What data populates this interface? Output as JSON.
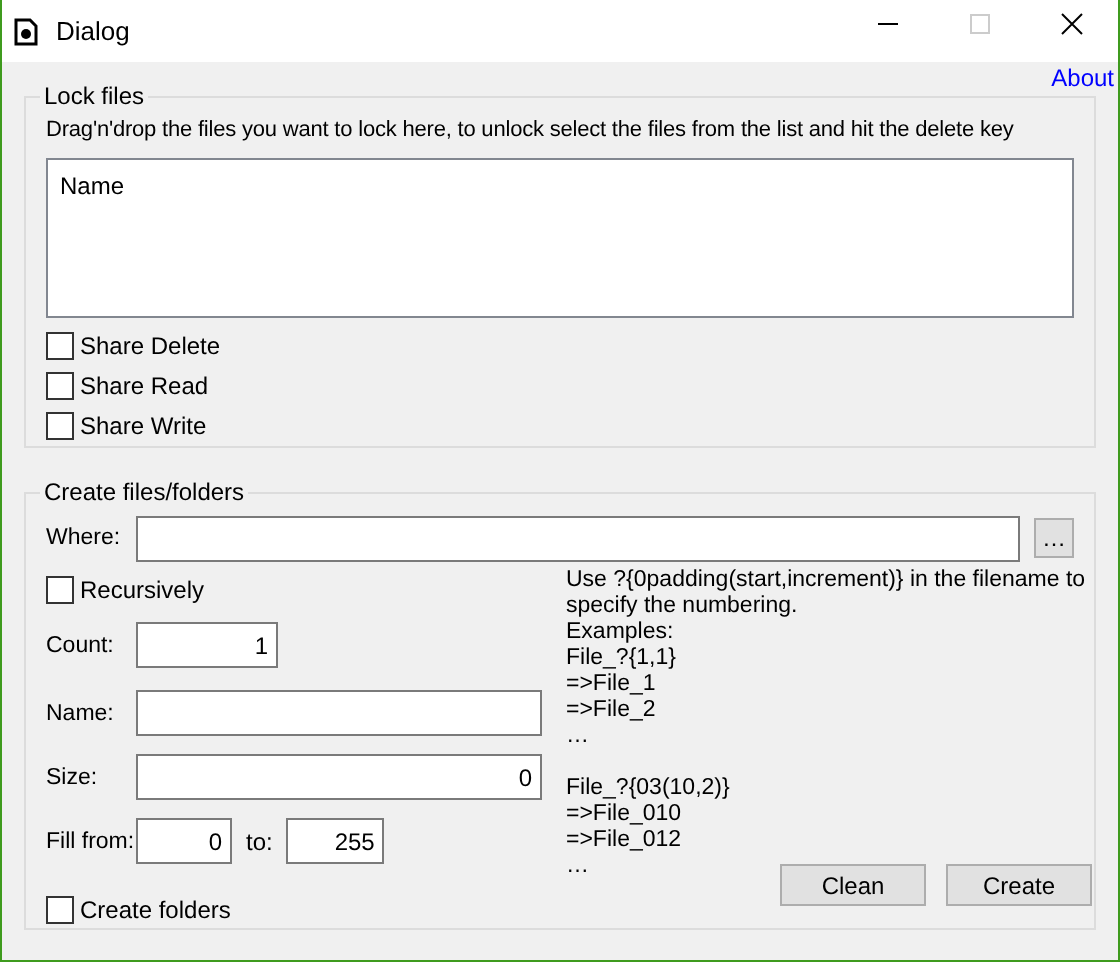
{
  "window": {
    "title": "Dialog",
    "maximize_disabled": true
  },
  "about_link": "About",
  "lock_files": {
    "title": "Lock files",
    "instruction": "Drag'n'drop the files you want to lock here, to unlock select the files from the list and hit the delete key",
    "list": {
      "columns": [
        "Name"
      ]
    },
    "options": [
      {
        "label": "Share Delete",
        "checked": false
      },
      {
        "label": "Share Read",
        "checked": false
      },
      {
        "label": "Share Write",
        "checked": false
      }
    ]
  },
  "create": {
    "title": "Create files/folders",
    "where": {
      "label": "Where:",
      "browse": "…"
    },
    "recursively": {
      "label": "Recursively",
      "checked": false
    },
    "count": {
      "label": "Count:",
      "value": "1"
    },
    "name": {
      "label": "Name:"
    },
    "size": {
      "label": "Size:",
      "value": "0"
    },
    "fill_from": {
      "label": "Fill from:",
      "value": "0"
    },
    "fill_to": {
      "label": "to:",
      "value": "255"
    },
    "create_folders": {
      "label": "Create folders",
      "checked": false
    },
    "help_blocks": [
      [
        "Use ?{0padding(start,increment)} in the filename to specify the numbering.",
        "Examples:",
        "File_?{1,1}",
        "=>File_1",
        "=>File_2",
        "…"
      ],
      [
        "File_?{03(10,2)}",
        "=>File_010",
        "=>File_012",
        "…"
      ]
    ],
    "buttons": [
      "Clean",
      "Create"
    ]
  }
}
